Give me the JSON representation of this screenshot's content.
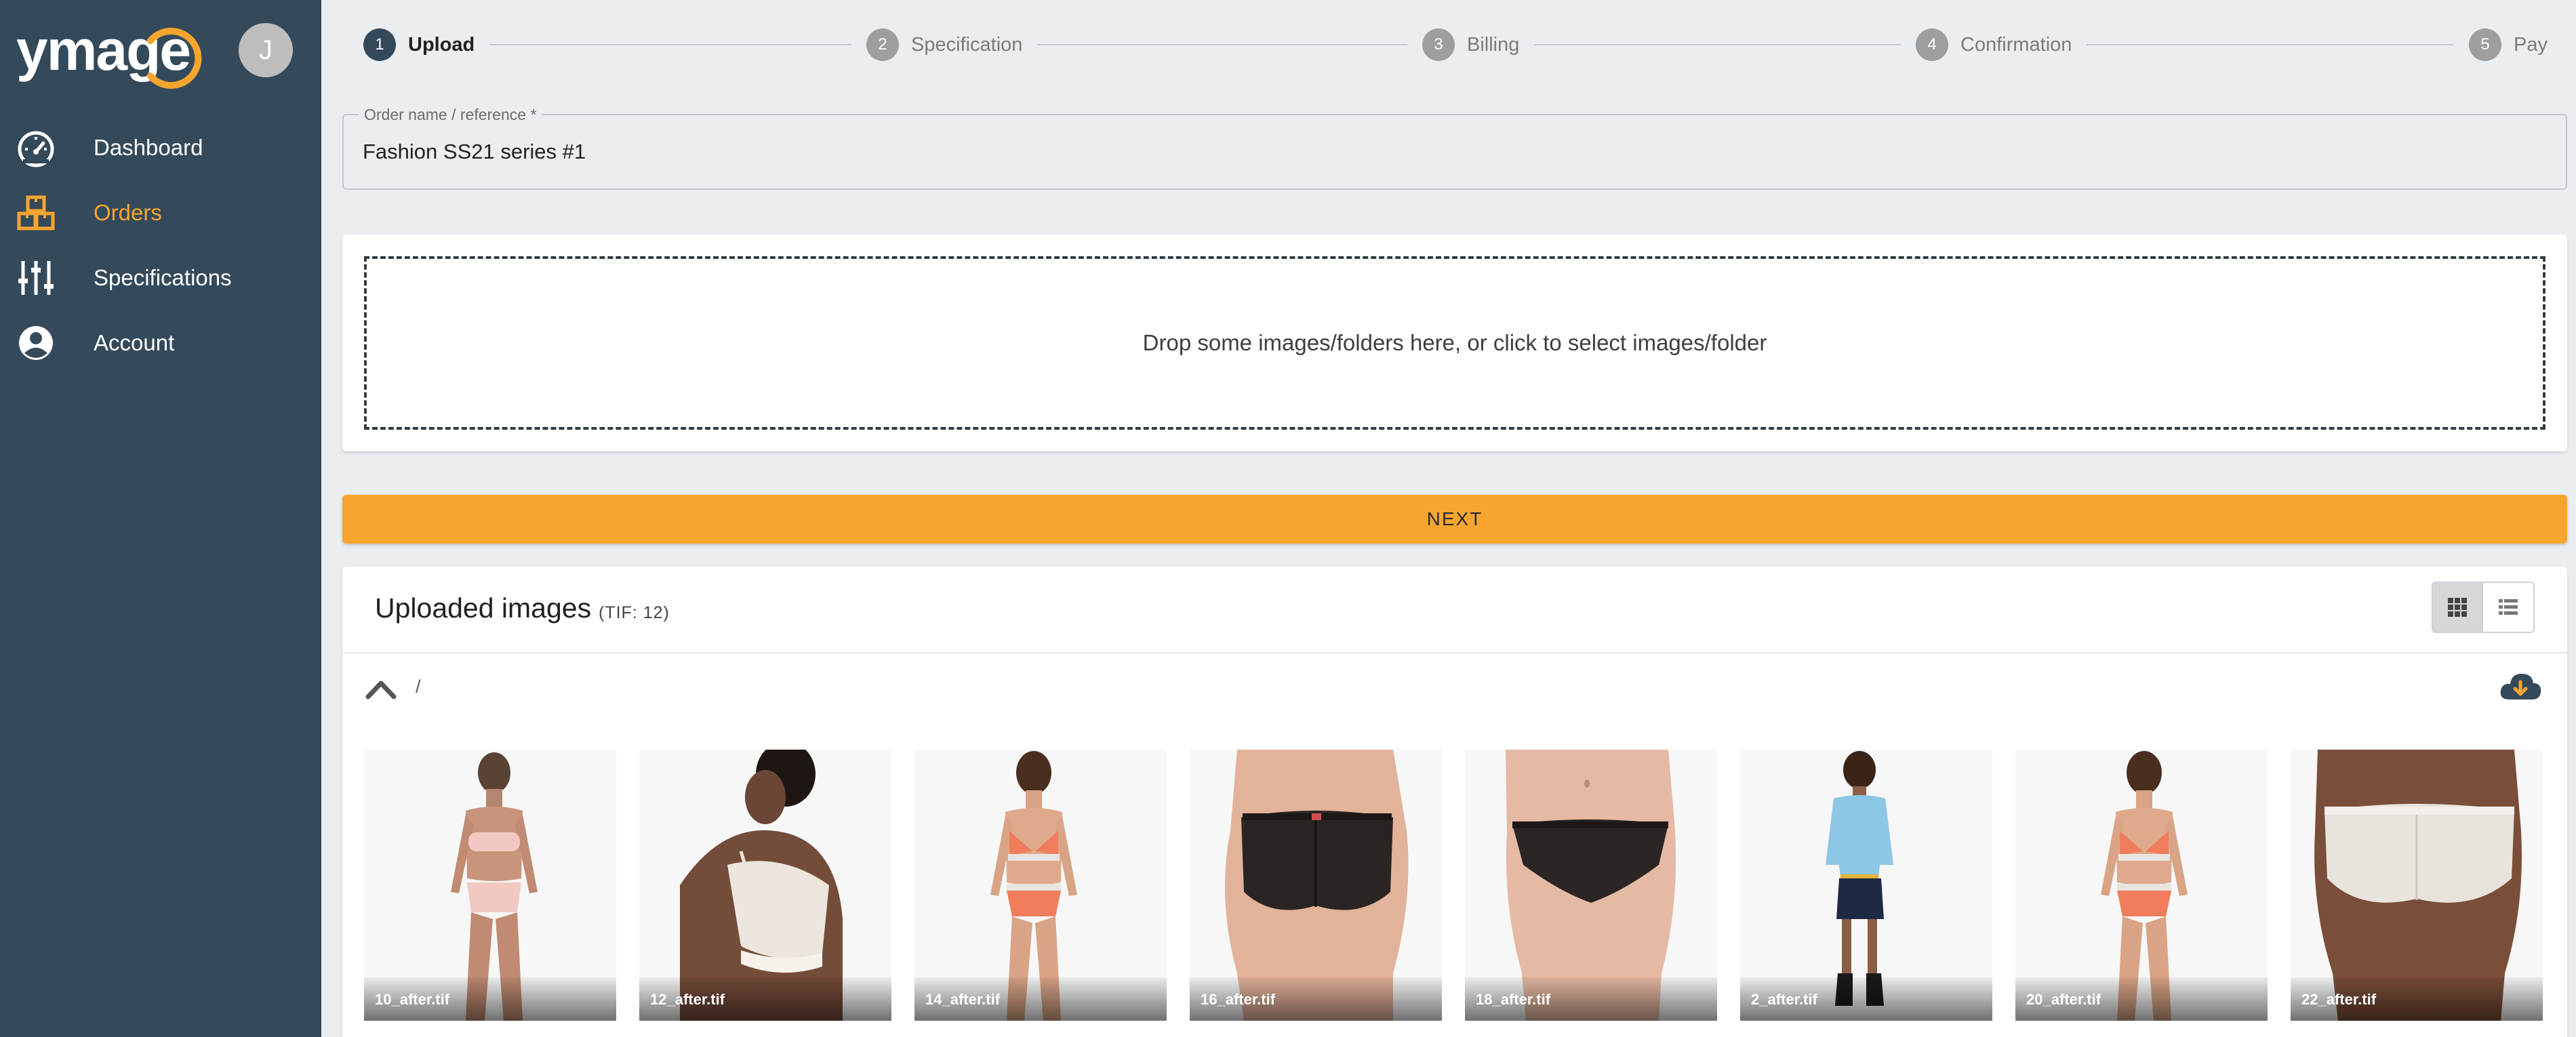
{
  "app": {
    "logo_text": "ymage",
    "user_initial": "J"
  },
  "sidebar": {
    "items": [
      {
        "label": "Dashboard",
        "icon": "speedometer-icon",
        "active": false
      },
      {
        "label": "Orders",
        "icon": "boxes-icon",
        "active": true
      },
      {
        "label": "Specifications",
        "icon": "sliders-icon",
        "active": false
      },
      {
        "label": "Account",
        "icon": "account-circle-icon",
        "active": false
      }
    ]
  },
  "stepper": {
    "steps": [
      {
        "number": "1",
        "label": "Upload",
        "active": true
      },
      {
        "number": "2",
        "label": "Specification",
        "active": false
      },
      {
        "number": "3",
        "label": "Billing",
        "active": false
      },
      {
        "number": "4",
        "label": "Confirmation",
        "active": false
      },
      {
        "number": "5",
        "label": "Pay",
        "active": false
      }
    ]
  },
  "order_field": {
    "label": "Order name / reference *",
    "value": "Fashion SS21 series #1"
  },
  "dropzone": {
    "text": "Drop some images/folders here, or click to select images/folder"
  },
  "next_button": {
    "label": "NEXT"
  },
  "uploads": {
    "title": "Uploaded images",
    "count_label": "(TIF: 12)",
    "folder_path": "/",
    "view_modes": [
      "grid-view-icon",
      "list-view-icon"
    ],
    "active_view": "grid",
    "images": [
      {
        "filename": "10_after.tif"
      },
      {
        "filename": "12_after.tif"
      },
      {
        "filename": "14_after.tif"
      },
      {
        "filename": "16_after.tif"
      },
      {
        "filename": "18_after.tif"
      },
      {
        "filename": "2_after.tif"
      },
      {
        "filename": "20_after.tif"
      },
      {
        "filename": "22_after.tif"
      }
    ]
  },
  "colors": {
    "sidebar_bg": "#34495a",
    "accent": "#f7a52f",
    "page_bg": "#ebeef1"
  }
}
